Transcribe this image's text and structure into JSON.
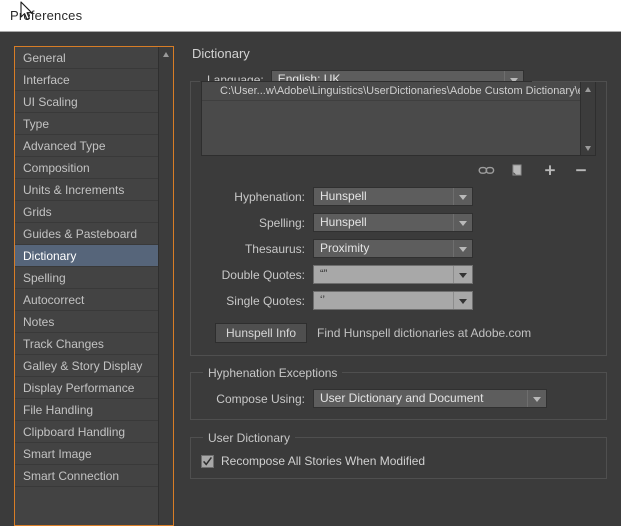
{
  "window": {
    "title": "Preferences"
  },
  "sidebar": {
    "items": [
      {
        "label": "General",
        "selected": false
      },
      {
        "label": "Interface",
        "selected": false
      },
      {
        "label": "UI Scaling",
        "selected": false
      },
      {
        "label": "Type",
        "selected": false
      },
      {
        "label": "Advanced Type",
        "selected": false
      },
      {
        "label": "Composition",
        "selected": false
      },
      {
        "label": "Units & Increments",
        "selected": false
      },
      {
        "label": "Grids",
        "selected": false
      },
      {
        "label": "Guides & Pasteboard",
        "selected": false
      },
      {
        "label": "Dictionary",
        "selected": true
      },
      {
        "label": "Spelling",
        "selected": false
      },
      {
        "label": "Autocorrect",
        "selected": false
      },
      {
        "label": "Notes",
        "selected": false
      },
      {
        "label": "Track Changes",
        "selected": false
      },
      {
        "label": "Galley & Story Display",
        "selected": false
      },
      {
        "label": "Display Performance",
        "selected": false
      },
      {
        "label": "File Handling",
        "selected": false
      },
      {
        "label": "Clipboard Handling",
        "selected": false
      },
      {
        "label": "Smart Image",
        "selected": false
      },
      {
        "label": "Smart Connection",
        "selected": false
      }
    ]
  },
  "panel": {
    "title": "Dictionary",
    "dictionary_group": {
      "language_label": "Language:",
      "language_value": "English: UK",
      "dictionary_paths": [
        "C:\\User...w\\Adobe\\Linguistics\\UserDictionaries\\Adobe Custom Dictionary\\en_GB"
      ],
      "icons": [
        {
          "name": "relink-icon",
          "title": "Relink user dictionary"
        },
        {
          "name": "new-dictionary-icon",
          "title": "New user dictionary"
        },
        {
          "name": "add-dictionary-icon",
          "title": "Add user dictionary"
        },
        {
          "name": "remove-dictionary-icon",
          "title": "Remove user dictionary"
        }
      ],
      "fields": [
        {
          "label": "Hyphenation:",
          "value": "Hunspell",
          "style": "dark"
        },
        {
          "label": "Spelling:",
          "value": "Hunspell",
          "style": "dark"
        },
        {
          "label": "Thesaurus:",
          "value": "Proximity",
          "style": "dark"
        },
        {
          "label": "Double Quotes:",
          "value": "“”",
          "style": "light"
        },
        {
          "label": "Single Quotes:",
          "value": "‘’",
          "style": "light"
        }
      ],
      "hunspell_button": "Hunspell Info",
      "hunspell_hint": "Find Hunspell dictionaries at Adobe.com"
    },
    "hyphenation_exceptions": {
      "group_label": "Hyphenation Exceptions",
      "compose_label": "Compose Using:",
      "compose_value": "User Dictionary and Document"
    },
    "user_dictionary": {
      "group_label": "User Dictionary",
      "recompose_label": "Recompose All Stories When Modified",
      "recompose_checked": true
    }
  },
  "colors": {
    "dialog_bg": "#3b3b3b",
    "titlebar_bg": "#ffffff",
    "selection": "#56657a",
    "sidebar_focus_border": "#d87d26",
    "text": "#c8c8c8"
  }
}
